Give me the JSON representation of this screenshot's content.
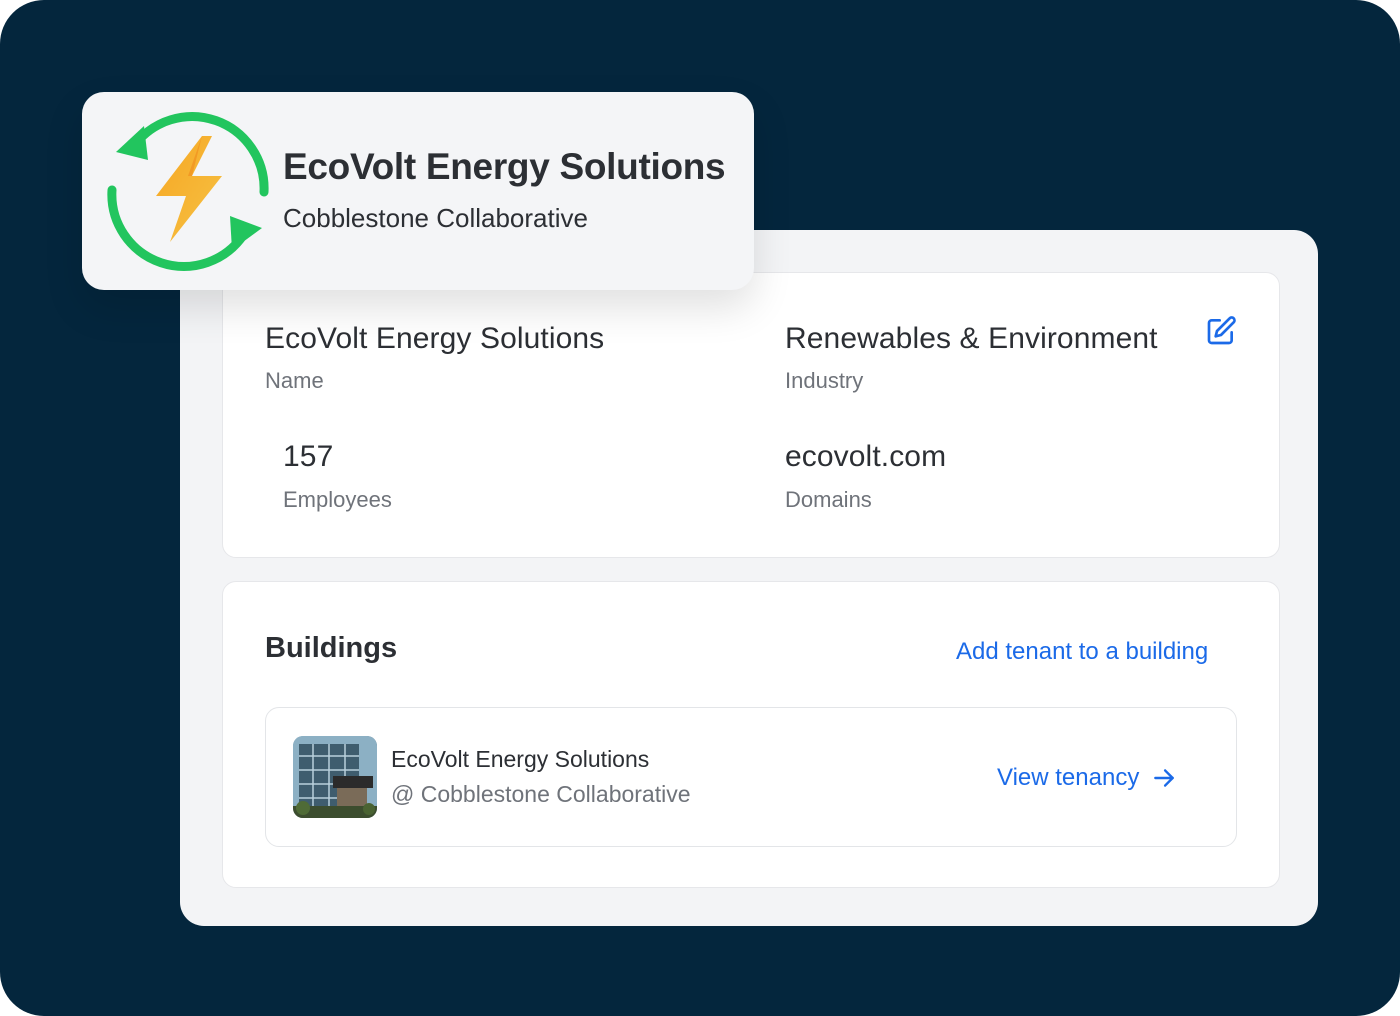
{
  "header_card": {
    "company_name": "EcoVolt Energy Solutions",
    "building_name": "Cobblestone Collaborative"
  },
  "details": {
    "name_value": "EcoVolt Energy Solutions",
    "name_label": "Name",
    "industry_value": "Renewables & Environment",
    "industry_label": "Industry",
    "employees_value": "157",
    "employees_label": "Employees",
    "domains_value": "ecovolt.com",
    "domains_label": "Domains"
  },
  "buildings": {
    "title": "Buildings",
    "add_link": "Add tenant to a building",
    "items": [
      {
        "name": "EcoVolt Energy Solutions",
        "location": "@ Cobblestone Collaborative",
        "action": "View tenancy"
      }
    ]
  },
  "icons": {
    "logo": "lightning-refresh-icon",
    "edit": "edit-icon",
    "arrow": "arrow-right-icon"
  },
  "colors": {
    "background": "#04263d",
    "accent": "#1b6ae8",
    "logo_green": "#22c55e",
    "logo_orange": "#f59e0b"
  }
}
